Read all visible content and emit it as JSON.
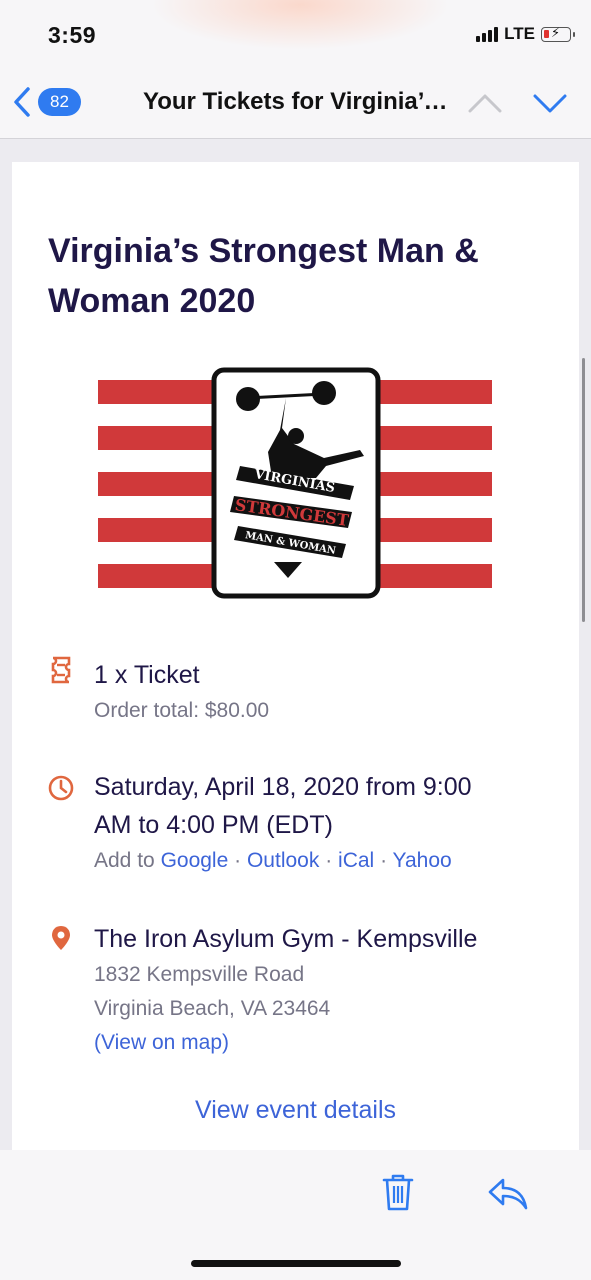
{
  "status": {
    "time": "3:59",
    "network": "LTE"
  },
  "nav": {
    "back_count": "82",
    "title": "Your Tickets for Virginia’s Strongest Man & Woman 2020"
  },
  "email": {
    "event_title": "Virginia’s Strongest Man & Woman 2020",
    "logo": {
      "line1": "VIRGINIAS",
      "line2": "STRONGEST",
      "line3": "MAN & WOMAN",
      "colors": {
        "stripes": "#d0393a",
        "ink": "#111111"
      }
    },
    "ticket": {
      "title": "1 x Ticket",
      "order_total": "Order total: $80.00"
    },
    "datetime": {
      "line1": "Saturday, April 18, 2020 from 9:00",
      "line2": "AM to 4:00 PM (EDT)",
      "add_to": "Add to",
      "calendars": [
        "Google",
        "Outlook",
        "iCal",
        "Yahoo"
      ],
      "separator": "·"
    },
    "location": {
      "venue": "The Iron Asylum Gym - Kempsville",
      "street": "1832 Kempsville Road",
      "city": "Virginia Beach, VA 23464",
      "map_link": "(View on map)"
    },
    "view_event_details": "View event details"
  },
  "toolbar": {
    "icons": [
      "trash-icon",
      "reply-icon"
    ]
  },
  "colors": {
    "accent": "#2f7bf0",
    "link": "#3d64d8",
    "icon_orange": "#e0673f",
    "title": "#1f1747"
  }
}
